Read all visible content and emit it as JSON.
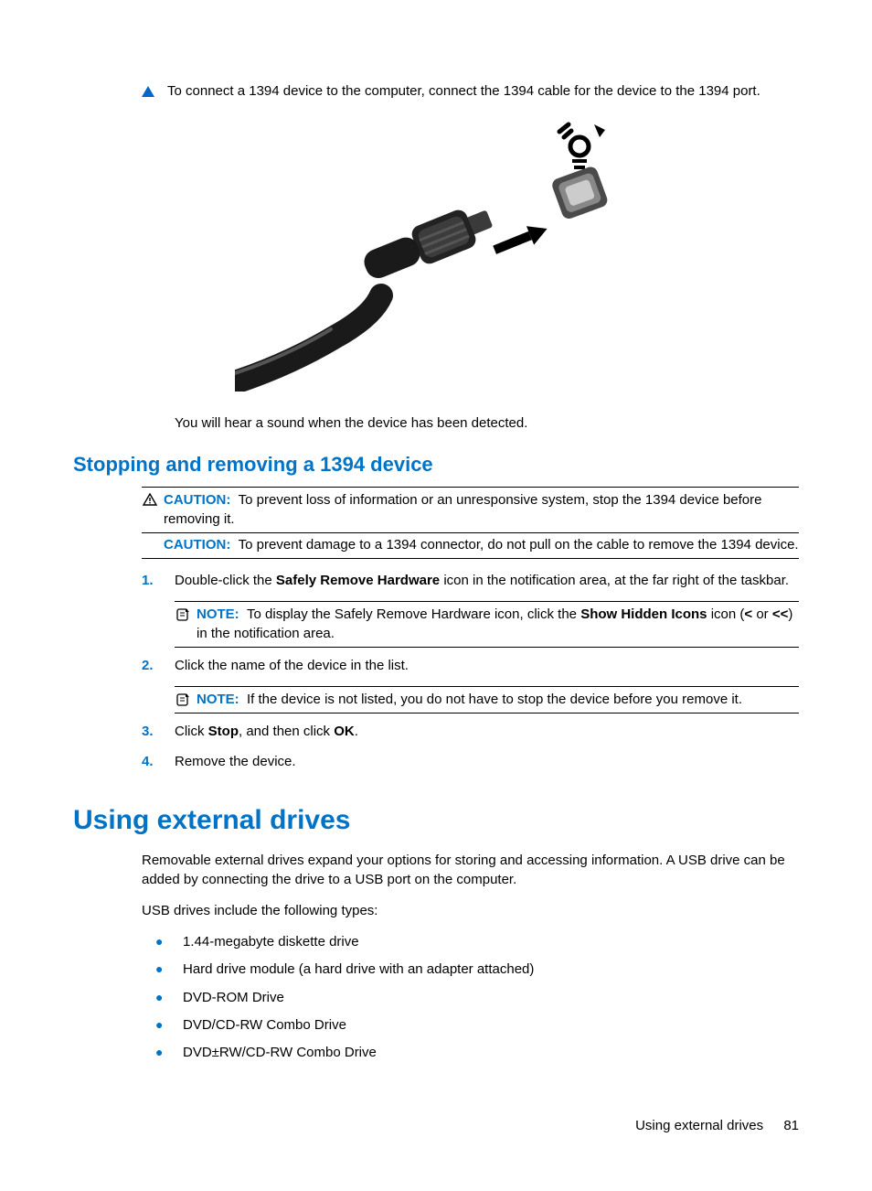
{
  "intro": {
    "step": "To connect a 1394 device to the computer, connect the 1394 cable for the device to the 1394 port.",
    "after_image": "You will hear a sound when the device has been detected."
  },
  "section1": {
    "heading": "Stopping and removing a 1394 device",
    "caution1_label": "CAUTION:",
    "caution1_text": "To prevent loss of information or an unresponsive system, stop the 1394 device before removing it.",
    "caution2_label": "CAUTION:",
    "caution2_text": "To prevent damage to a 1394 connector, do not pull on the cable to remove the 1394 device.",
    "steps": [
      {
        "num": "1.",
        "pre": "Double-click the ",
        "bold": "Safely Remove Hardware",
        "post": " icon in the notification area, at the far right of the taskbar."
      },
      {
        "num": "2.",
        "pre": "Click the name of the device in the list.",
        "bold": "",
        "post": ""
      },
      {
        "num": "3.",
        "pre": "Click ",
        "bold": "Stop",
        "mid": ", and then click ",
        "bold2": "OK",
        "post": "."
      },
      {
        "num": "4.",
        "pre": "Remove the device.",
        "bold": "",
        "post": ""
      }
    ],
    "note1_label": "NOTE:",
    "note1_pre": "To display the Safely Remove Hardware icon, click the ",
    "note1_bold": "Show Hidden Icons",
    "note1_mid": " icon (",
    "note1_bold2": "<",
    "note1_mid2": " or ",
    "note1_bold3": "<<",
    "note1_post": ") in the notification area.",
    "note2_label": "NOTE:",
    "note2_text": "If the device is not listed, you do not have to stop the device before you remove it."
  },
  "section2": {
    "heading": "Using external drives",
    "para1": "Removable external drives expand your options for storing and accessing information. A USB drive can be added by connecting the drive to a USB port on the computer.",
    "para2": "USB drives include the following types:",
    "bullets": [
      "1.44-megabyte diskette drive",
      "Hard drive module (a hard drive with an adapter attached)",
      "DVD-ROM Drive",
      "DVD/CD-RW Combo Drive",
      "DVD±RW/CD-RW Combo Drive"
    ]
  },
  "footer": {
    "text": "Using external drives",
    "page": "81"
  }
}
